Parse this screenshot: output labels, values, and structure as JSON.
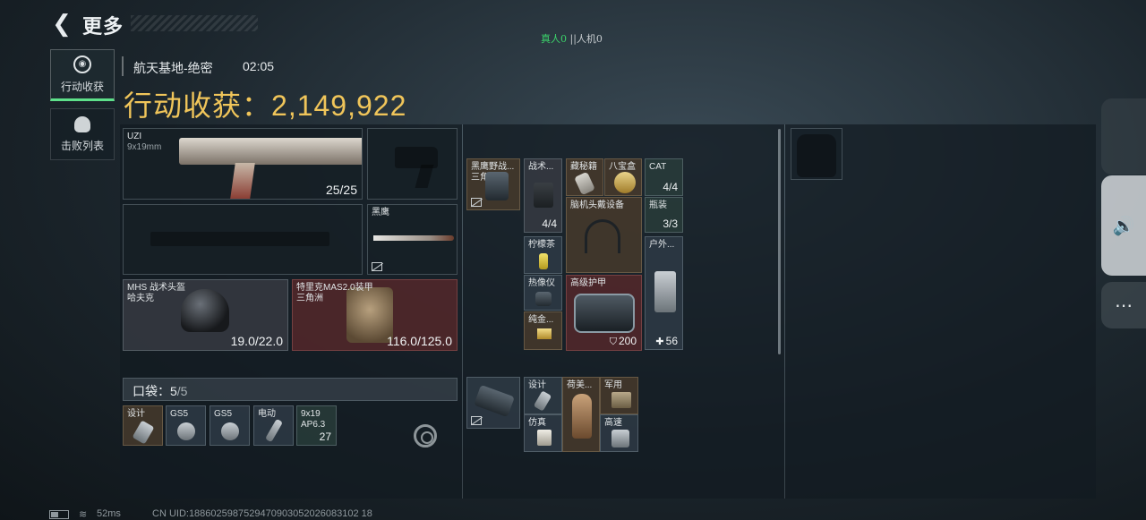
{
  "topbar": {
    "back_glyph": "❮",
    "title": "更多",
    "real_players": "真人0",
    "separator": "||",
    "bots": "人机0"
  },
  "tabs": [
    {
      "label": "行动收获",
      "icon": "target-icon",
      "active": true
    },
    {
      "label": "击败列表",
      "icon": "skull-icon",
      "active": false
    }
  ],
  "header": {
    "map": "航天基地-绝密",
    "time": "02:05",
    "earnings_label": "行动收获：",
    "earnings_value": "2,149,922"
  },
  "loadout": {
    "primary": {
      "name": "UZI",
      "ammo_type": "9x19mm",
      "ammo": "25/25"
    },
    "sidearm": {
      "name": ""
    },
    "secondary": {
      "name": ""
    },
    "melee": {
      "name": "黑鹰"
    },
    "helmet": {
      "name": "MHS 战术头盔",
      "sub": "哈夫克",
      "durability": "19.0/22.0"
    },
    "armor": {
      "name": "特里克MAS2.0装甲",
      "sub": "三角洲",
      "durability": "116.0/125.0"
    }
  },
  "pockets": {
    "label": "口袋：",
    "count": "5",
    "capacity": "/5",
    "items": [
      {
        "label": "设计",
        "count": ""
      },
      {
        "label": "GS5",
        "count": ""
      },
      {
        "label": "GS5",
        "count": ""
      },
      {
        "label": "电动",
        "count": ""
      },
      {
        "label": "9x19 AP6.3",
        "count": "27"
      }
    ]
  },
  "rig": {
    "slot1": {
      "label": "黑鹰野战...",
      "sub": "三角洲"
    },
    "medkit": {
      "label": "战术...",
      "count": "4/4"
    },
    "secret": {
      "label": "藏秘籍"
    },
    "octo": {
      "label": "八宝盒"
    },
    "cat": {
      "label": "CAT",
      "count": "4/4"
    },
    "bottle": {
      "label": "瓶装",
      "count": "3/3"
    },
    "headset": {
      "label": "脑机头戴设备"
    },
    "tea": {
      "label": "柠檬茶"
    },
    "outdoor": {
      "label": "户外...",
      "count": "56"
    },
    "thermal": {
      "label": "热像仪"
    },
    "gold": {
      "label": "纯金..."
    },
    "armor_case": {
      "label": "高级护甲",
      "count": "200"
    }
  },
  "backpack": {
    "design": {
      "label": "设计"
    },
    "figure": {
      "label": "荷美..."
    },
    "military": {
      "label": "军用"
    },
    "fake": {
      "label": "仿真"
    },
    "highspeed": {
      "label": "高速"
    }
  },
  "side_buttons": {
    "volume_icon": "🔊",
    "more_icon": "⋯"
  },
  "status": {
    "ping": "52ms",
    "uid": "CN UID:1886025987529470903052026083102 18"
  }
}
